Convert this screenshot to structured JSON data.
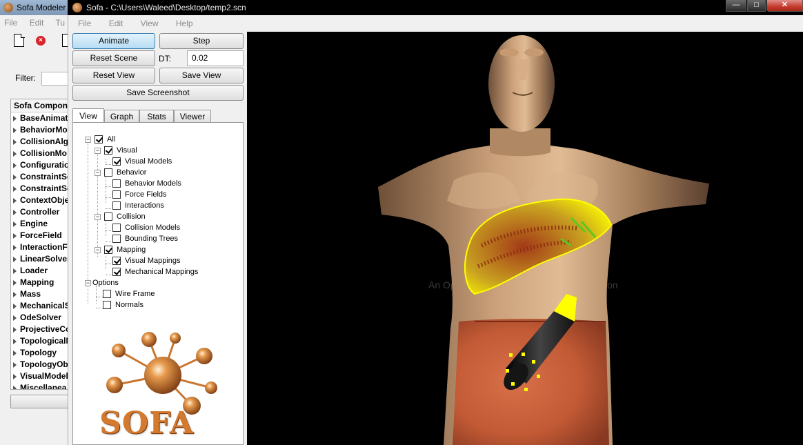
{
  "modeler": {
    "title": "Sofa Modeler",
    "menu": [
      "File",
      "Edit",
      "Tu"
    ],
    "filter_label": "Filter:",
    "filter_value": "",
    "list_header": "Sofa Compone",
    "categories": [
      "BaseAnimati",
      "BehaviorMo",
      "CollisionAlgo",
      "CollisionMo",
      "Configuratio",
      "ConstraintSe",
      "ConstraintSe",
      "ContextObje",
      "Controller",
      "Engine",
      "ForceField",
      "InteractionF",
      "LinearSolver",
      "Loader",
      "Mapping",
      "Mass",
      "MechanicalS",
      "OdeSolver",
      "ProjectiveCo",
      "TopologicalM",
      "Topology",
      "TopologyObj",
      "VisualModel",
      "Miscellanea"
    ]
  },
  "main": {
    "title": "Sofa - C:\\Users\\Waleed\\Desktop/temp2.scn",
    "menu": [
      "File",
      "Edit",
      "View",
      "Help"
    ],
    "controls": {
      "animate": "Animate",
      "step": "Step",
      "reset_scene": "Reset Scene",
      "dt_label": "DT:",
      "dt_value": "0.02",
      "reset_view": "Reset View",
      "save_view": "Save View",
      "save_screenshot": "Save Screenshot"
    },
    "tabs": [
      "View",
      "Graph",
      "Stats",
      "Viewer"
    ],
    "tree": {
      "all": "All",
      "visual": "Visual",
      "visual_models": "Visual Models",
      "behavior": "Behavior",
      "behavior_models": "Behavior Models",
      "force_fields": "Force Fields",
      "interactions": "Interactions",
      "collision": "Collision",
      "collision_models": "Collision Models",
      "bounding_trees": "Bounding Trees",
      "mapping": "Mapping",
      "visual_mappings": "Visual Mappings",
      "mechanical_mappings": "Mechanical Mappings",
      "options": "Options",
      "wire_frame": "Wire Frame",
      "normals": "Normals"
    },
    "logo_text": "SOFA",
    "viewport": {
      "watermark": "An Open"
    }
  },
  "colors": {
    "animate_active": "#b6dcf3",
    "viewport_bg": "#000000",
    "skin": "#b88a62",
    "liver": "#ffff00",
    "instrument": "#1a1a1a"
  }
}
